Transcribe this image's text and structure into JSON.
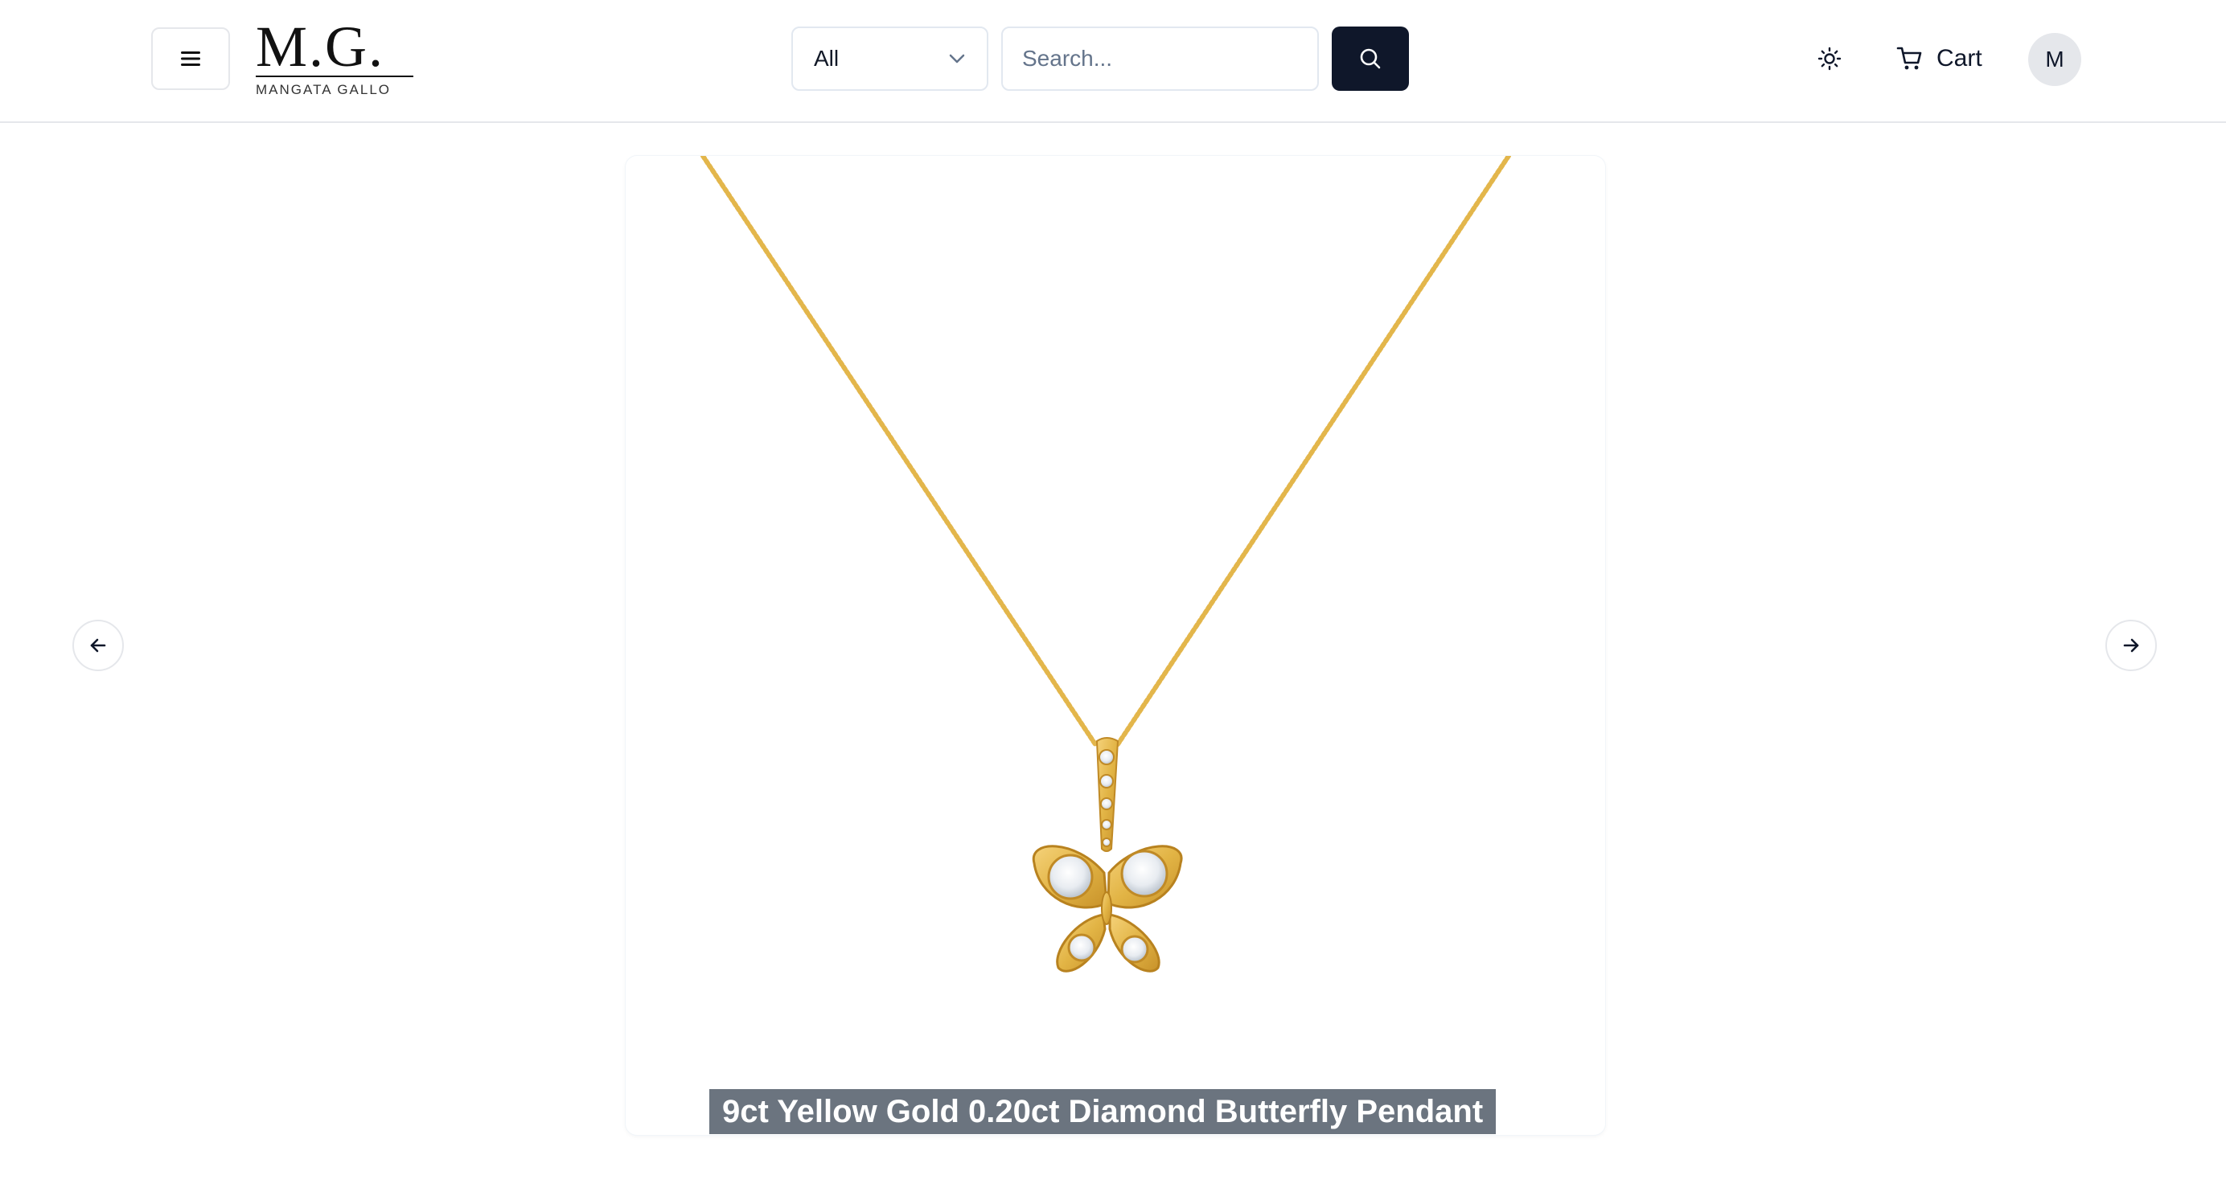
{
  "header": {
    "menu_icon": "hamburger-menu-icon",
    "logo": {
      "mark": "M.G.",
      "subtitle": "MANGATA GALLO"
    },
    "search": {
      "category_selected": "All",
      "placeholder": "Search...",
      "value": "",
      "button_icon": "search-icon"
    },
    "theme_icon": "sun-icon",
    "cart_label": "Cart",
    "cart_icon": "shopping-cart-icon",
    "avatar_initial": "M"
  },
  "carousel": {
    "product_title": "9ct Yellow Gold 0.20ct Diamond Butterfly Pendant",
    "prev_icon": "arrow-left-icon",
    "next_icon": "arrow-right-icon"
  },
  "colors": {
    "primary_dark": "#0f172a",
    "gold": "#e6b84a",
    "title_overlay": "#6b7280"
  }
}
